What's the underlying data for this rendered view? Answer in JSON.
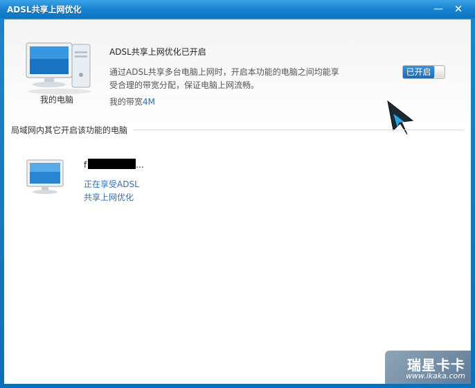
{
  "window": {
    "title": "ADSL共享上网优化",
    "minimize_label": "—",
    "close_label": "✕"
  },
  "top": {
    "my_computer_label": "我的电脑",
    "headline": "ADSL共享上网优化已开启",
    "description": "通过ADSL共享多台电脑上网时，开启本功能的电脑之间均能享受合理的带宽分配，保证电脑上网流畅。",
    "bandwidth_label": "我的带宽",
    "bandwidth_value": "4M",
    "toggle_label": "已开启",
    "toggle_state": "on"
  },
  "lan": {
    "section_title": "局域网内其它开启该功能的电脑",
    "computers": [
      {
        "name_prefix": "f",
        "name_suffix": "...",
        "status_line1": "正在享受ADSL",
        "status_line2": "共享上网优化"
      }
    ]
  },
  "watermark": {
    "brand": "瑞星卡卡",
    "url": "www.ikaka.com"
  },
  "colors": {
    "titlebar": "#1b86d2",
    "link": "#2f6fb5",
    "toggle_on": "#1a6db5"
  },
  "icons": [
    "computer-icon",
    "small-computer-icon",
    "mouse-cursor-icon"
  ]
}
